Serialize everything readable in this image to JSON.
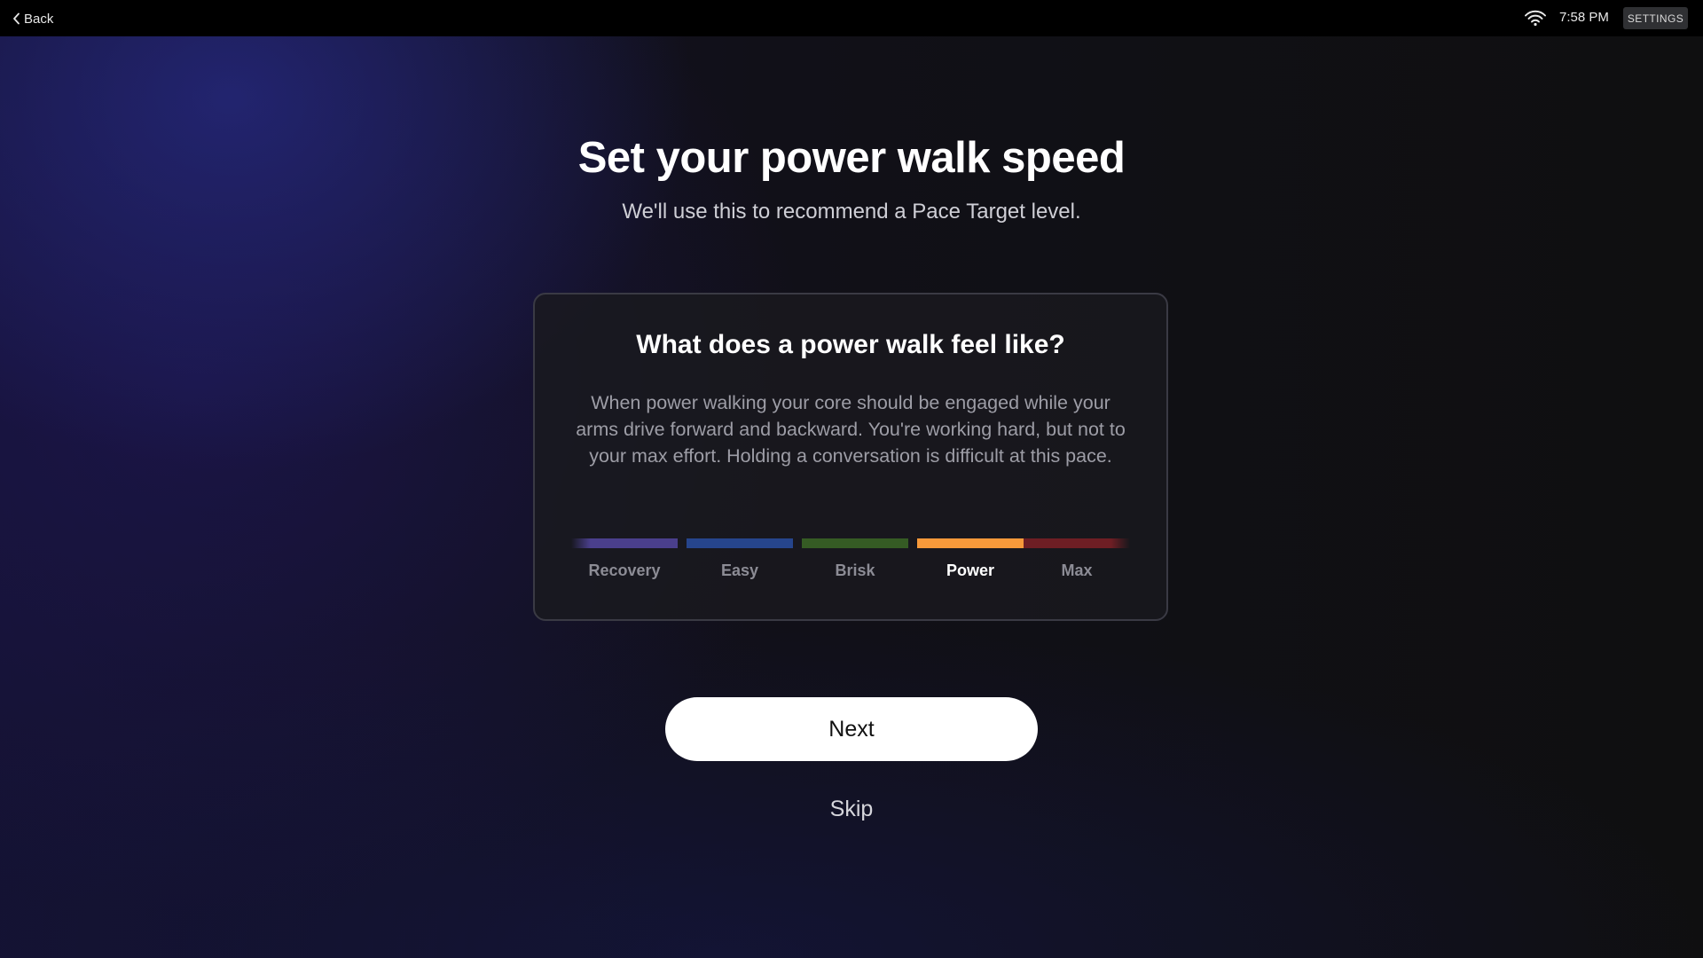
{
  "status_bar": {
    "back_label": "Back",
    "time": "7:58 PM",
    "settings_label": "SETTINGS",
    "wifi_icon": "wifi-icon"
  },
  "header": {
    "title": "Set your power walk speed",
    "subtitle": "We'll use this to recommend a Pace Target level."
  },
  "info_card": {
    "title": "What does a power walk feel like?",
    "body": "When power walking your core should be engaged while your arms drive forward and backward. You're working hard, but not to your max effort. Holding a conversation is difficult at this pace.",
    "zones": [
      {
        "label": "Recovery",
        "color": "#4a3f8c",
        "active": false
      },
      {
        "label": "Easy",
        "color": "#26458c",
        "active": false
      },
      {
        "label": "Brisk",
        "color": "#355b24",
        "active": false
      },
      {
        "label": "Power",
        "color": "#f7993a",
        "active": true
      },
      {
        "label": "Max",
        "color": "#6e1e24",
        "active": false
      }
    ],
    "selected_zone": "Power"
  },
  "actions": {
    "next_label": "Next",
    "skip_label": "Skip"
  }
}
